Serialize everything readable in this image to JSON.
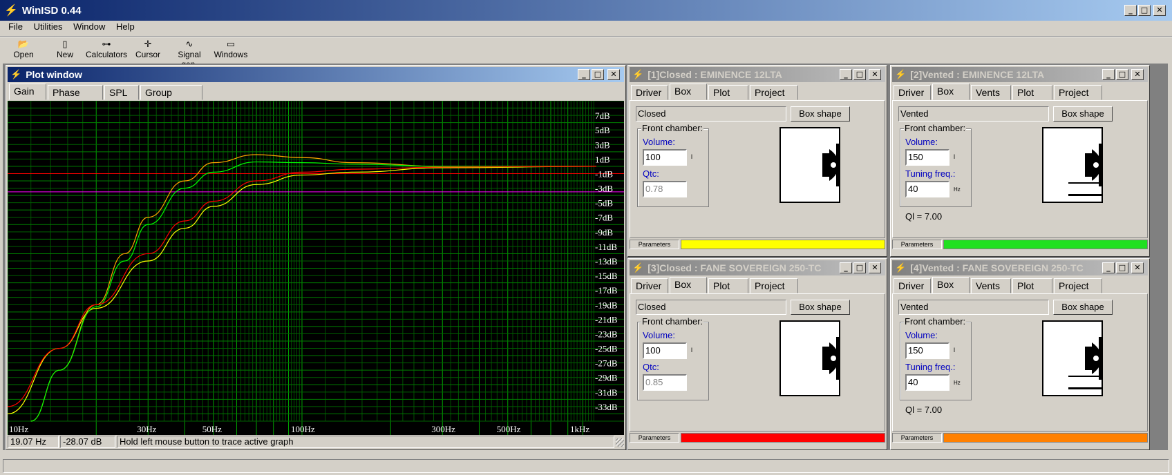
{
  "app": {
    "title": "WinISD 0.44"
  },
  "menu": [
    "File",
    "Utilities",
    "Window",
    "Help"
  ],
  "toolbar": [
    {
      "label": "Open",
      "icon": "folder-open-icon"
    },
    {
      "label": "New",
      "icon": "new-document-icon"
    },
    {
      "label": "Calculators",
      "icon": "sliders-icon"
    },
    {
      "label": "Cursor",
      "icon": "crosshair-icon"
    },
    {
      "label": "Signal gen.",
      "icon": "sine-wave-icon"
    },
    {
      "label": "Windows",
      "icon": "window-icon"
    }
  ],
  "plot": {
    "title": "Plot window",
    "tabs": [
      "Gain",
      "Phase plot",
      "SPL",
      "Group delay"
    ],
    "status": {
      "freq": "19.07 Hz",
      "level": "-28.07 dB",
      "hint": "Hold left mouse button to trace active graph"
    },
    "y_labels": [
      "7dB",
      "5dB",
      "3dB",
      "1dB",
      "-1dB",
      "-3dB",
      "-5dB",
      "-7dB",
      "-9dB",
      "-11dB",
      "-13dB",
      "-15dB",
      "-17dB",
      "-19dB",
      "-21dB",
      "-23dB",
      "-25dB",
      "-27dB",
      "-29dB",
      "-31dB",
      "-33dB"
    ],
    "x_labels": [
      "10Hz",
      "30Hz",
      "50Hz",
      "100Hz",
      "300Hz",
      "500Hz",
      "1kHz"
    ]
  },
  "chart_data": {
    "type": "line",
    "xscale": "log",
    "xlim": [
      10,
      1000
    ],
    "ylim": [
      -35,
      9
    ],
    "series": [
      {
        "color": "#ffff00",
        "points": [
          [
            10,
            -34
          ],
          [
            15,
            -25
          ],
          [
            20,
            -19.5
          ],
          [
            30,
            -13
          ],
          [
            40,
            -8.5
          ],
          [
            50,
            -5.5
          ],
          [
            70,
            -2.5
          ],
          [
            100,
            -1.2
          ],
          [
            150,
            -0.8
          ],
          [
            300,
            -0.2
          ],
          [
            1000,
            0
          ]
        ]
      },
      {
        "color": "#ffa500",
        "points": [
          [
            12,
            -35
          ],
          [
            15,
            -28
          ],
          [
            20,
            -19
          ],
          [
            25,
            -12
          ],
          [
            30,
            -7
          ],
          [
            40,
            -2
          ],
          [
            50,
            0.5
          ],
          [
            70,
            1.6
          ],
          [
            100,
            1.2
          ],
          [
            150,
            0.5
          ],
          [
            300,
            0
          ],
          [
            1000,
            0
          ]
        ]
      },
      {
        "color": "#00ff00",
        "points": [
          [
            12,
            -35
          ],
          [
            15,
            -28
          ],
          [
            20,
            -19.3
          ],
          [
            25,
            -13
          ],
          [
            30,
            -8
          ],
          [
            40,
            -3
          ],
          [
            50,
            -0.8
          ],
          [
            70,
            0.6
          ],
          [
            100,
            0.5
          ],
          [
            150,
            0.3
          ],
          [
            300,
            0
          ],
          [
            1000,
            0
          ]
        ]
      },
      {
        "color": "#ff0000",
        "points": [
          [
            10,
            -33
          ],
          [
            15,
            -25
          ],
          [
            20,
            -19
          ],
          [
            30,
            -12
          ],
          [
            40,
            -7.5
          ],
          [
            50,
            -4.8
          ],
          [
            70,
            -2
          ],
          [
            100,
            -0.8
          ],
          [
            150,
            -0.4
          ],
          [
            300,
            -0.1
          ],
          [
            1000,
            0
          ]
        ]
      }
    ],
    "reference_lines": [
      {
        "y": -1,
        "color": "#ff0000"
      },
      {
        "y": -3.5,
        "color": "#ff00ff"
      }
    ]
  },
  "panels": [
    {
      "title": "[1]Closed : EMINENCE 12LTA",
      "tabs": [
        "Driver",
        "Box",
        "Plot",
        "Project"
      ],
      "box_type": "Closed",
      "box_shape_label": "Box shape",
      "front_label": "Front chamber:",
      "volume_label": "Volume:",
      "volume": "100",
      "volume_unit": "l",
      "second_label": "Qtc:",
      "second_value": "0.78",
      "second_unit": "",
      "ql": "",
      "params_label": "Parameters",
      "color": "#ffff00"
    },
    {
      "title": "[2]Vented : EMINENCE 12LTA",
      "tabs": [
        "Driver",
        "Box",
        "Vents",
        "Plot",
        "Project"
      ],
      "box_type": "Vented",
      "box_shape_label": "Box shape",
      "front_label": "Front chamber:",
      "volume_label": "Volume:",
      "volume": "150",
      "volume_unit": "l",
      "second_label": "Tuning freq.:",
      "second_value": "40",
      "second_unit": "Hz",
      "ql": "Ql = 7.00",
      "params_label": "Parameters",
      "color": "#20e020"
    },
    {
      "title": "[3]Closed : FANE SOVEREIGN 250-TC",
      "tabs": [
        "Driver",
        "Box",
        "Plot",
        "Project"
      ],
      "box_type": "Closed",
      "box_shape_label": "Box shape",
      "front_label": "Front chamber:",
      "volume_label": "Volume:",
      "volume": "100",
      "volume_unit": "l",
      "second_label": "Qtc:",
      "second_value": "0.85",
      "second_unit": "",
      "ql": "",
      "params_label": "Parameters",
      "color": "#ff0000"
    },
    {
      "title": "[4]Vented : FANE SOVEREIGN 250-TC",
      "tabs": [
        "Driver",
        "Box",
        "Vents",
        "Plot",
        "Project"
      ],
      "box_type": "Vented",
      "box_shape_label": "Box shape",
      "front_label": "Front chamber:",
      "volume_label": "Volume:",
      "volume": "150",
      "volume_unit": "l",
      "second_label": "Tuning freq.:",
      "second_value": "40",
      "second_unit": "Hz",
      "ql": "Ql = 7.00",
      "params_label": "Parameters",
      "color": "#ff8000"
    }
  ]
}
